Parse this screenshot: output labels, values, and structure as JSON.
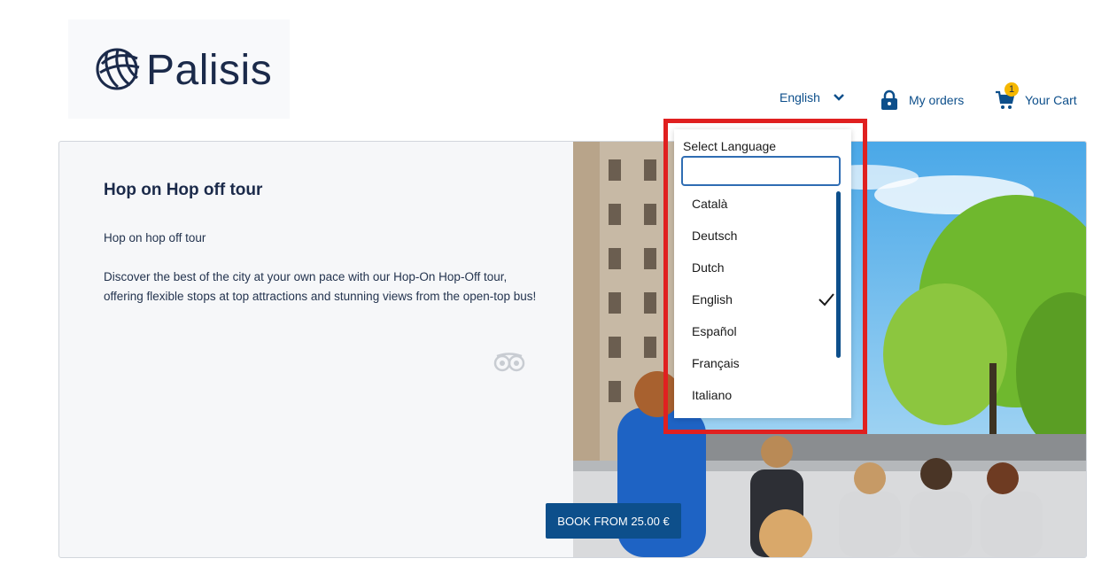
{
  "brand": {
    "name": "Palisis"
  },
  "header": {
    "language": "English",
    "my_orders": "My orders",
    "cart_label": "Your Cart",
    "cart_count": "1"
  },
  "tour": {
    "title": "Hop on Hop off tour",
    "subtitle": "Hop on hop off tour",
    "description": "Discover the best of the city at your own pace with our Hop-On Hop-Off tour, offering flexible stops at top attractions and stunning views from the open-top bus!",
    "book_label": "BOOK FROM 25.00 €"
  },
  "language_dropdown": {
    "label": "Select Language",
    "search_value": "",
    "selected": "English",
    "options": [
      "Català",
      "Deutsch",
      "Dutch",
      "English",
      "Español",
      "Français",
      "Italiano"
    ]
  },
  "colors": {
    "brand_blue": "#0d4f8b",
    "badge_yellow": "#f5b700",
    "highlight_red": "#e02020"
  }
}
